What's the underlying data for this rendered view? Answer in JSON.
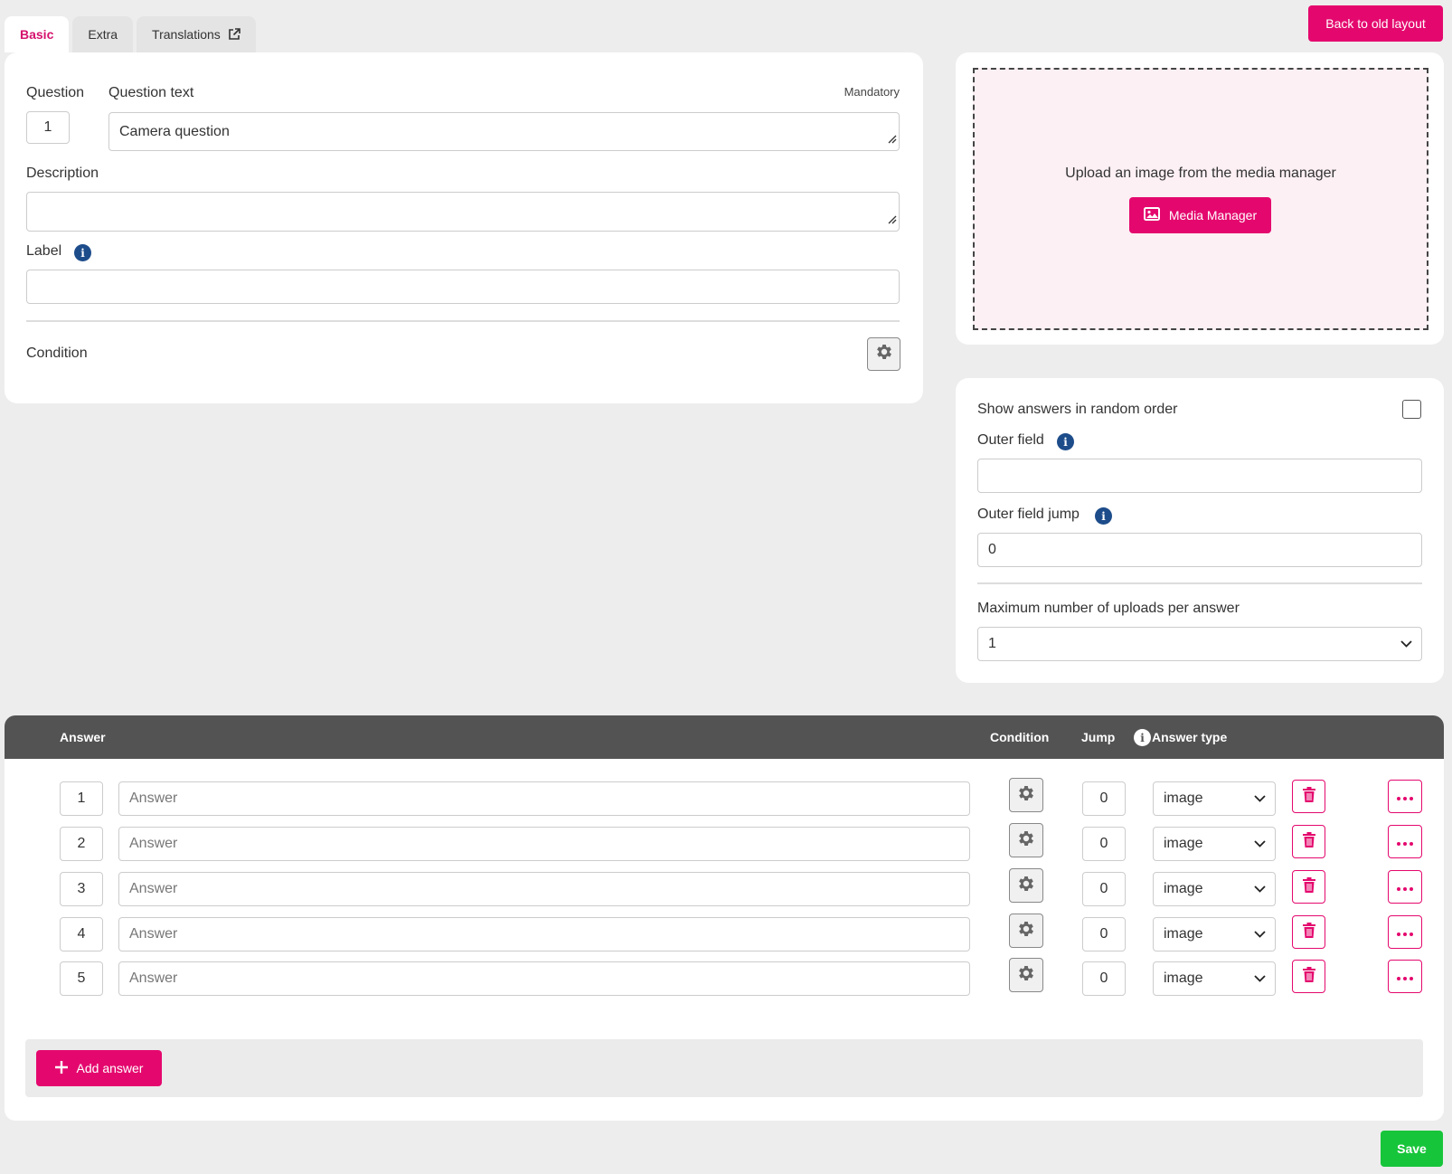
{
  "tabs": [
    {
      "label": "Basic",
      "active": true
    },
    {
      "label": "Extra",
      "active": false
    },
    {
      "label": "Translations",
      "active": false,
      "icon": "external-link-icon"
    }
  ],
  "header": {
    "back_label": "Back to old layout"
  },
  "basic": {
    "question_label": "Question",
    "question_number": "1",
    "question_text_label": "Question text",
    "mandatory_label": "Mandatory",
    "question_text_value": "Camera question",
    "description_label": "Description",
    "description_value": "",
    "label_label": "Label",
    "label_value": "",
    "condition_label": "Condition"
  },
  "media": {
    "upload_text": "Upload an image from the media manager",
    "button_label": "Media Manager"
  },
  "options": {
    "random_order_label": "Show answers in random order",
    "random_order_checked": false,
    "outer_field_label": "Outer field",
    "outer_field_value": "",
    "outer_field_jump_label": "Outer field jump",
    "outer_field_jump_value": "0",
    "max_uploads_label": "Maximum number of uploads per answer",
    "max_uploads_value": "1"
  },
  "answers_table": {
    "headers": {
      "answer": "Answer",
      "condition": "Condition",
      "jump": "Jump",
      "answer_type": "Answer type"
    },
    "rows": [
      {
        "number": "1",
        "placeholder": "Answer",
        "jump": "0",
        "type": "image"
      },
      {
        "number": "2",
        "placeholder": "Answer",
        "jump": "0",
        "type": "image"
      },
      {
        "number": "3",
        "placeholder": "Answer",
        "jump": "0",
        "type": "image"
      },
      {
        "number": "4",
        "placeholder": "Answer",
        "jump": "0",
        "type": "image"
      },
      {
        "number": "5",
        "placeholder": "Answer",
        "jump": "0",
        "type": "image"
      }
    ],
    "add_label": "Add answer"
  },
  "footer": {
    "save_label": "Save"
  },
  "colors": {
    "accent": "#e4086e",
    "save": "#17c53a",
    "info": "#1d4c8a",
    "table_header": "#535353"
  }
}
